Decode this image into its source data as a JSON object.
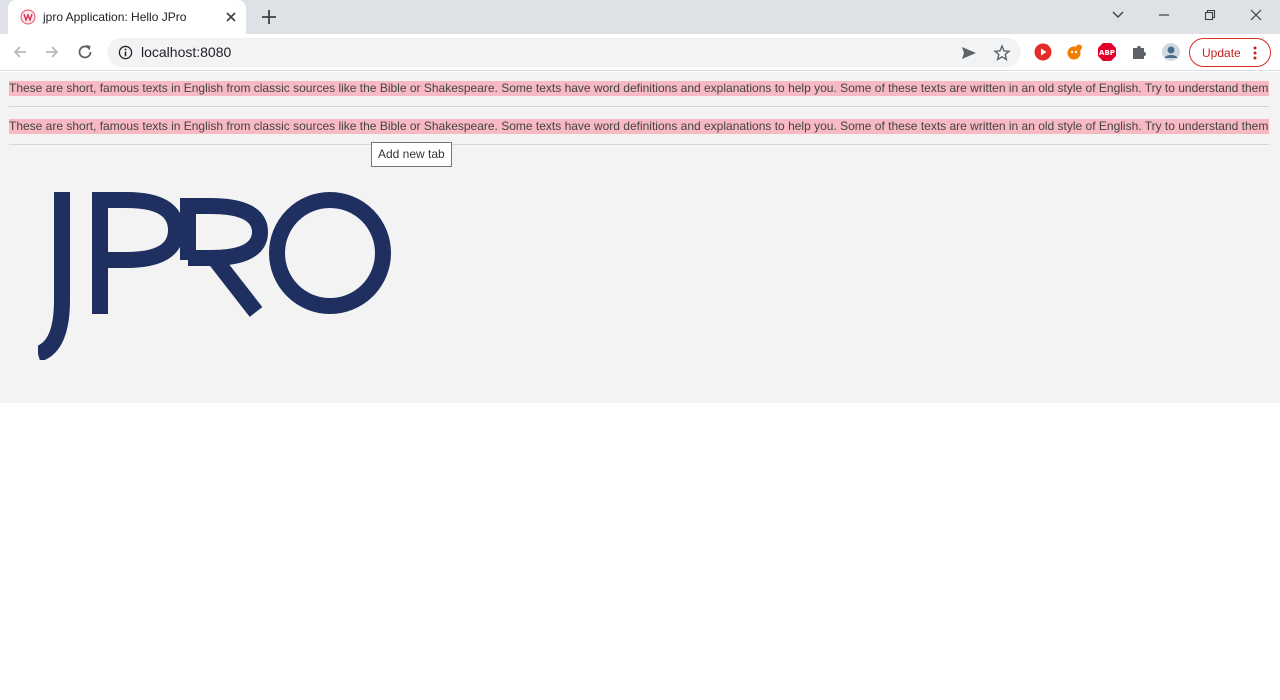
{
  "browser": {
    "tab": {
      "title": "jpro Application: Hello JPro"
    },
    "url": "localhost:8080",
    "update_label": "Update"
  },
  "page": {
    "rows": [
      "These are short, famous texts in English from classic sources like the Bible or Shakespeare. Some texts have word definitions and explanations to help you. Some of these texts are written in an old style of English. Try to understand them",
      "These are short, famous texts in English from classic sources like the Bible or Shakespeare. Some texts have word definitions and explanations to help you. Some of these texts are written in an old style of English. Try to understand them"
    ],
    "tooltip": "Add new tab",
    "logo_text": "JPRO"
  },
  "colors": {
    "row_highlight": "#f7b9c3",
    "logo": "#1e2f60",
    "update_accent": "#d93025"
  }
}
